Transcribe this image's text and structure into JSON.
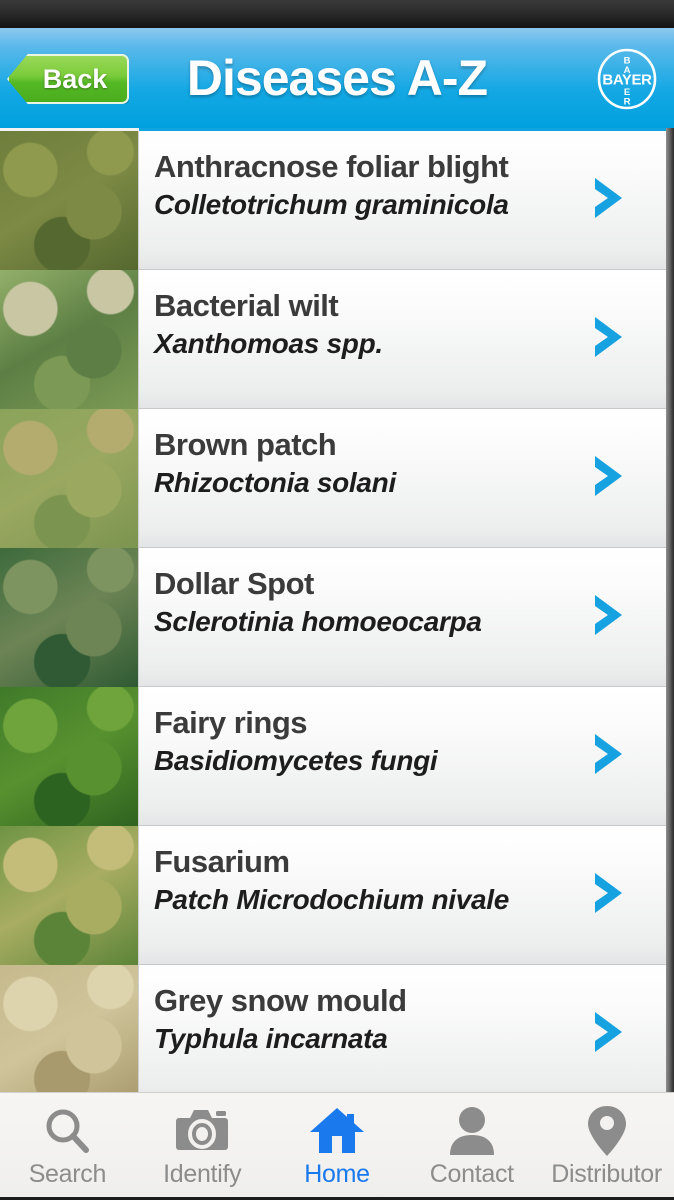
{
  "app": {
    "header": {
      "title": "Diseases A-Z",
      "back_label": "Back",
      "logo_name": "bayer-cross-logo",
      "logo_text": "BAYER",
      "bg_top_color": "#8cc8ee",
      "bg_bottom_color": "#00a0de",
      "back_color": "#6ec62f"
    },
    "list": {
      "accent_color": "#0fa3e0",
      "chevron_color": "#16a2e0",
      "rows": [
        {
          "title": "Anthracnose foliar blight",
          "scientific_name": "Colletotrichum graminicola",
          "thumb_name": "anthracnose-thumbnail",
          "thumb_colors": [
            "#6e7e3c",
            "#8f9a4e",
            "#55682f",
            "#7d8a45"
          ]
        },
        {
          "title": "Bacterial wilt",
          "scientific_name": "Xanthomoas spp.",
          "thumb_name": "bacterial-wilt-thumbnail",
          "thumb_colors": [
            "#93b06a",
            "#c9c6a4",
            "#7c9a55",
            "#5d7f45"
          ]
        },
        {
          "title": "Brown patch",
          "scientific_name": "Rhizoctonia solani",
          "thumb_name": "brown-patch-thumbnail",
          "thumb_colors": [
            "#8aa35a",
            "#b3ac6e",
            "#7b9450",
            "#9aa860"
          ]
        },
        {
          "title": "Dollar Spot",
          "scientific_name": "Sclerotinia homoeocarpa",
          "thumb_name": "dollar-spot-thumbnail",
          "thumb_colors": [
            "#3d6b3c",
            "#7e9460",
            "#2f5a33",
            "#6d8455"
          ]
        },
        {
          "title": "Fairy rings",
          "scientific_name": "Basidiomycetes fungi",
          "thumb_name": "fairy-rings-thumbnail",
          "thumb_colors": [
            "#3f7a2a",
            "#6fa43c",
            "#2d6320",
            "#58912f"
          ]
        },
        {
          "title": "Fusarium",
          "scientific_name": "Patch Microdochium nivale",
          "thumb_name": "fusarium-thumbnail",
          "thumb_colors": [
            "#6f9444",
            "#c3bd79",
            "#5c8438",
            "#a8ad62"
          ]
        },
        {
          "title": "Grey snow mould",
          "scientific_name": "Typhula incarnata",
          "thumb_name": "grey-snow-mould-thumbnail",
          "thumb_colors": [
            "#c6b98e",
            "#ddd3ac",
            "#a89a6d",
            "#cfc49a"
          ]
        }
      ]
    },
    "tabbar": {
      "active_color": "#1a7aed",
      "inactive_color": "#8c8c8c",
      "tabs": [
        {
          "label": "Search",
          "icon": "search-icon",
          "active": false
        },
        {
          "label": "Identify",
          "icon": "camera-icon",
          "active": false
        },
        {
          "label": "Home",
          "icon": "home-icon",
          "active": true
        },
        {
          "label": "Contact",
          "icon": "person-icon",
          "active": false
        },
        {
          "label": "Distributor",
          "icon": "map-pin-icon",
          "active": false
        }
      ]
    }
  }
}
